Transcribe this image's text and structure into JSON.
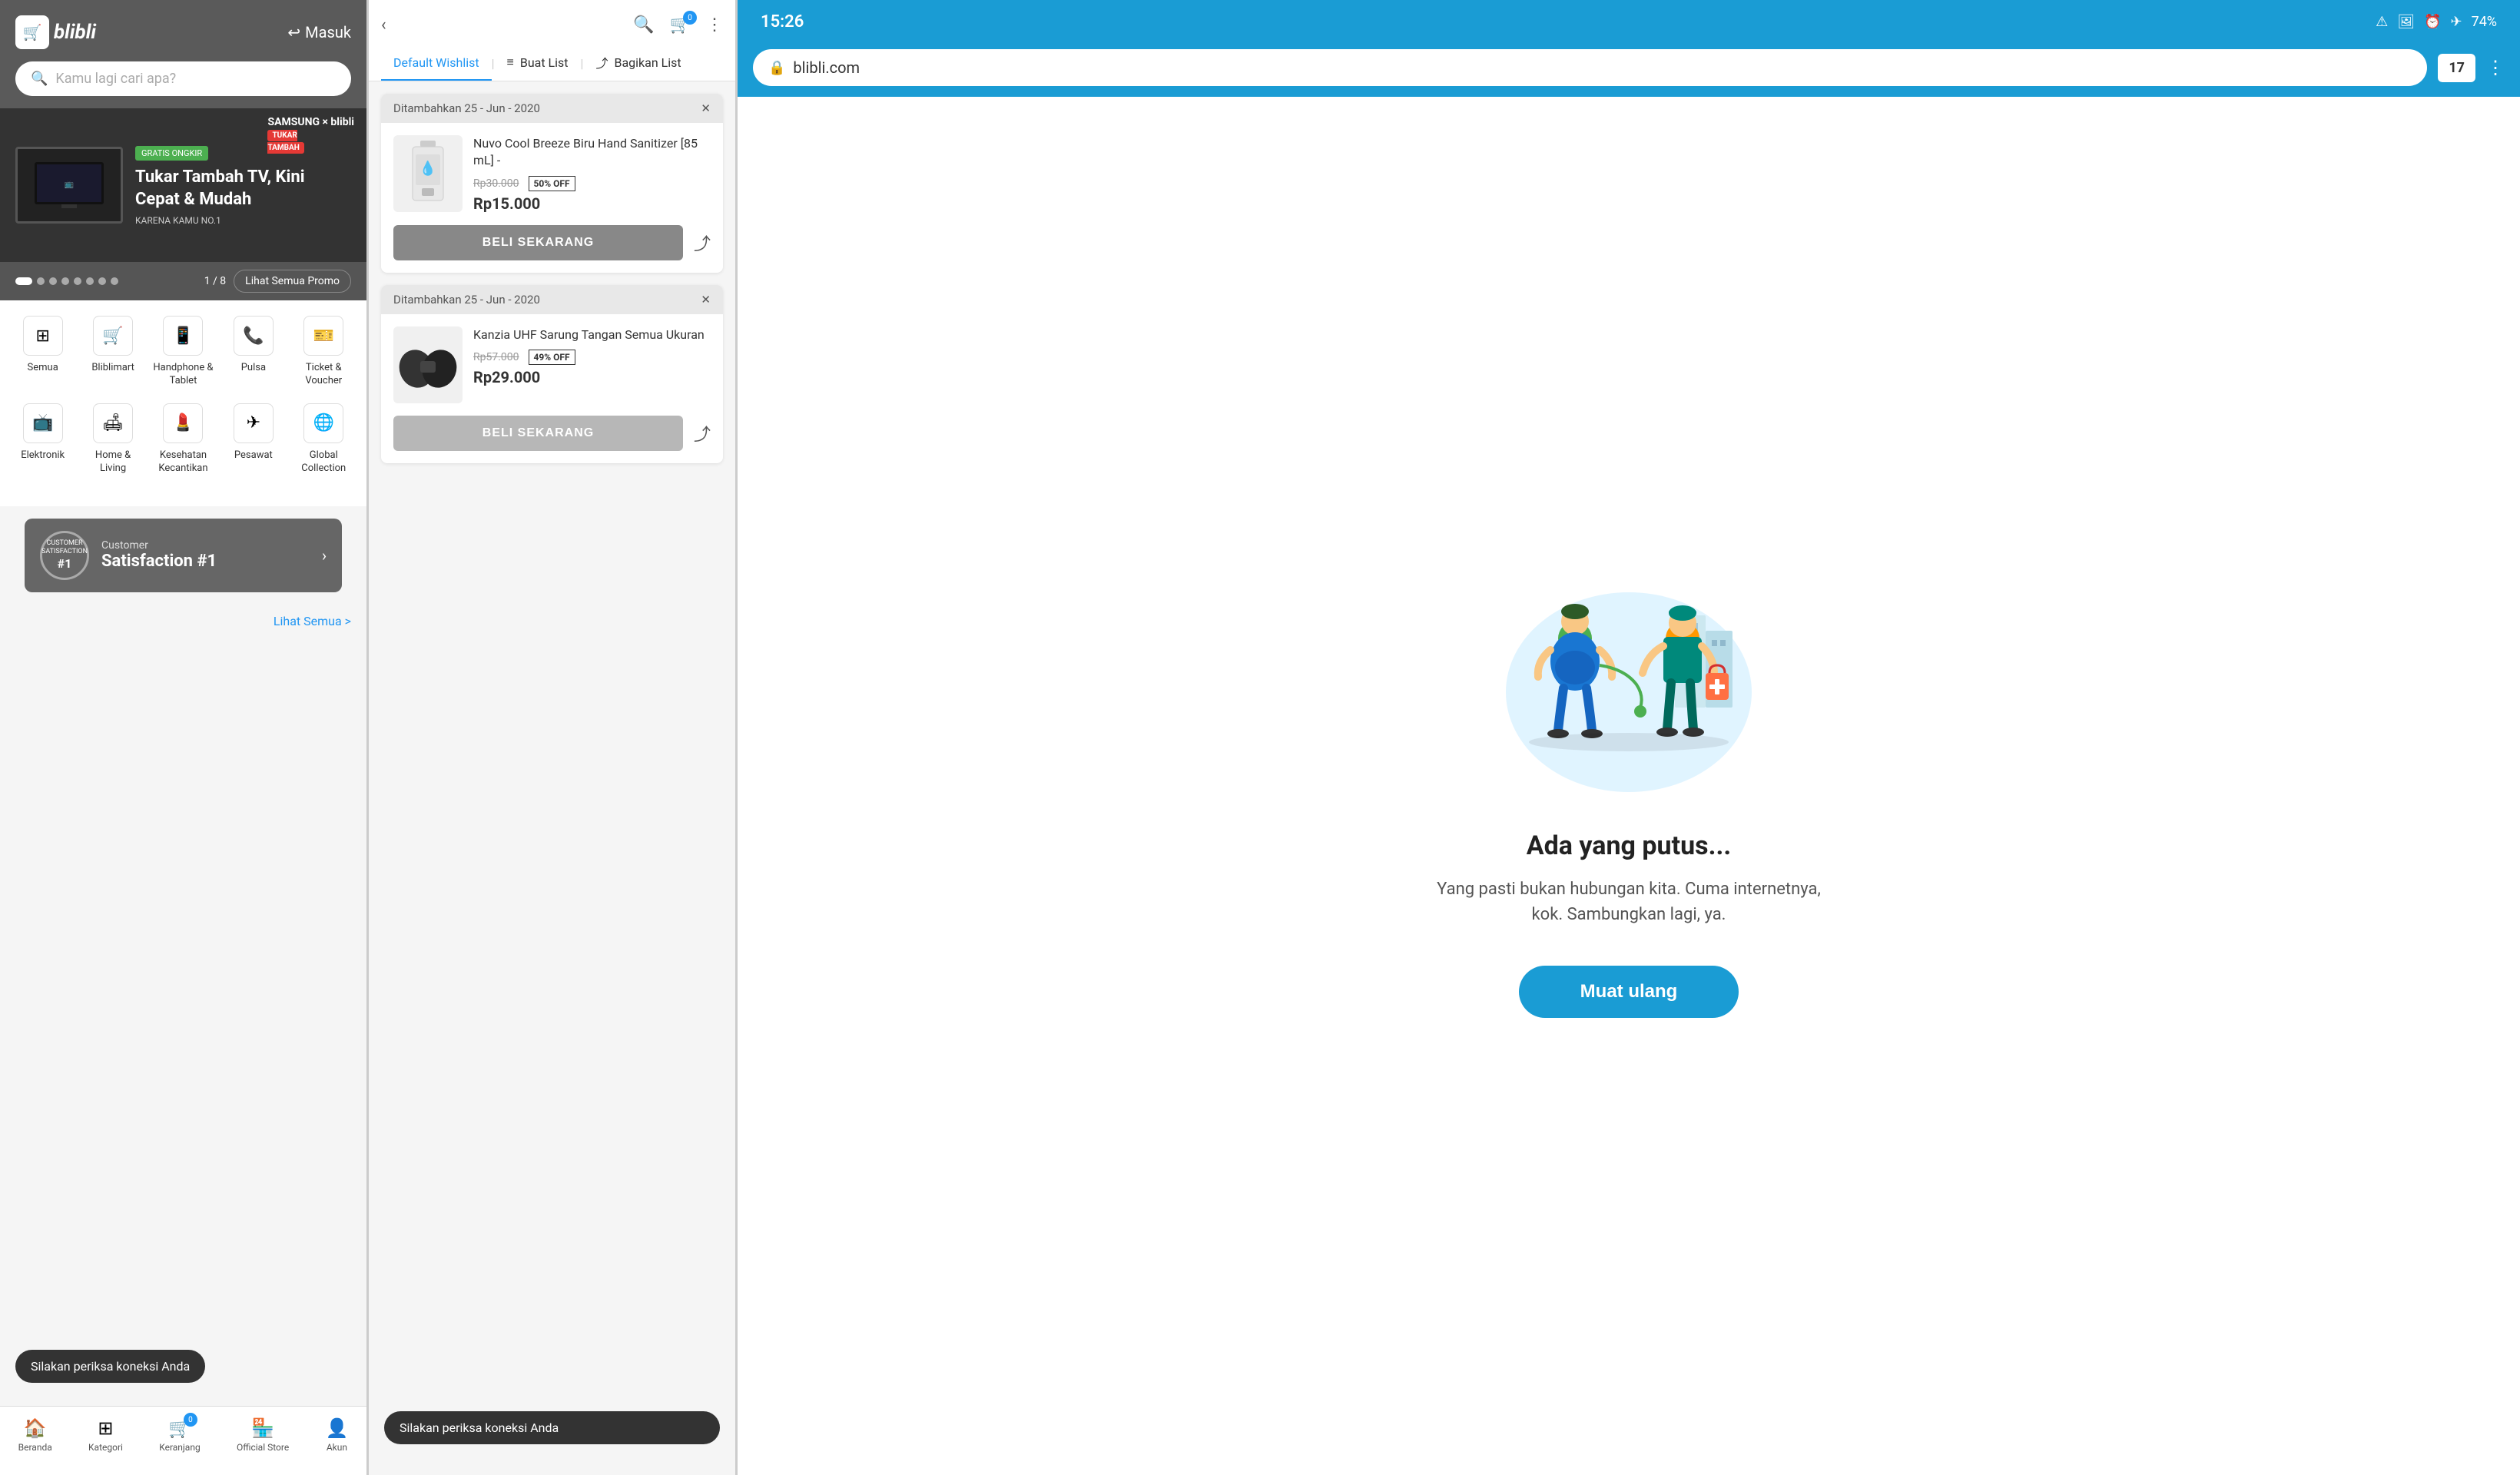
{
  "panel1": {
    "logo": "blibli",
    "logo_icon": "🛒",
    "masuk_label": "Masuk",
    "search_placeholder": "Kamu lagi cari apa?",
    "banner": {
      "badge": "GRATIS ONGKIR",
      "brand": "SAMSUNG × blibli",
      "tukar_label": "TUKAR TAMBAH",
      "title": "Tukar Tambah TV, Kini Cepat & Mudah",
      "subtitle": "KARENA KAMU NO.1"
    },
    "promo": {
      "page": "1 / 8",
      "lihat_label": "Lihat Semua Promo"
    },
    "categories": [
      {
        "label": "Semua",
        "icon": "⊞"
      },
      {
        "label": "Bliblimart",
        "icon": "🛒"
      },
      {
        "label": "Handphone & Tablet",
        "icon": "📱"
      },
      {
        "label": "Pulsa",
        "icon": "📞"
      },
      {
        "label": "Ticket & Voucher",
        "icon": "🎫"
      },
      {
        "label": "Elektronik",
        "icon": "📺"
      },
      {
        "label": "Home & Living",
        "icon": "🛋"
      },
      {
        "label": "Kesehatan Kecantikan",
        "icon": "💄"
      },
      {
        "label": "Pesawat",
        "icon": "✈"
      },
      {
        "label": "Global Collection",
        "icon": "🌐"
      }
    ],
    "satisfaction": {
      "badge": "#1",
      "sub": "Customer",
      "main": "Satisfaction #1"
    },
    "connection_toast": "Silakan periksa koneksi Anda",
    "lihat_semua": "Lihat Semua >",
    "bottom_nav": [
      {
        "label": "Beranda",
        "icon": "🏠"
      },
      {
        "label": "Kategori",
        "icon": "⊞"
      },
      {
        "label": "Keranjang",
        "icon": "🛒",
        "badge": "0"
      },
      {
        "label": "Official Store",
        "icon": "🏪"
      },
      {
        "label": "Akun",
        "icon": "👤"
      }
    ]
  },
  "panel2": {
    "back_icon": "‹",
    "search_icon": "🔍",
    "cart_badge": "0",
    "more_icon": "⋮",
    "tabs": [
      {
        "label": "Default Wishlist",
        "active": true
      },
      {
        "label": "Buat List"
      },
      {
        "label": "Bagikan List"
      }
    ],
    "products": [
      {
        "date_added": "Ditambahkan 25 - Jun - 2020",
        "name": "Nuvo Cool Breeze Biru Hand Sanitizer [85 mL] -",
        "original_price": "Rp30.000",
        "discount": "50% OFF",
        "sale_price": "Rp15.000",
        "buy_label": "BELI SEKARANG"
      },
      {
        "date_added": "Ditambahkan 25 - Jun - 2020",
        "name": "Kanzia UHF Sarung Tangan Semua Ukuran",
        "original_price": "Rp57.000",
        "discount": "49% OFF",
        "sale_price": "Rp29.000",
        "buy_label": "BELI SEKARANG"
      }
    ],
    "connection_toast": "Silakan periksa koneksi Anda"
  },
  "panel3": {
    "time": "15:26",
    "battery": "74%",
    "url": "blibli.com",
    "tab_count": "17",
    "error_title": "Ada yang putus...",
    "error_sub": "Yang pasti bukan hubungan kita. Cuma internetnya, kok. Sambungkan lagi, ya.",
    "reload_label": "Muat ulang"
  }
}
